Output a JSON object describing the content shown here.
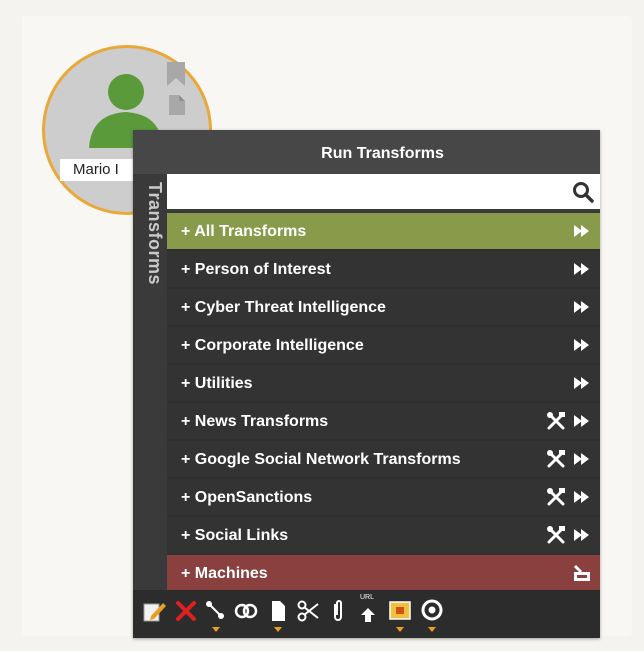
{
  "entity": {
    "label": "Mario I",
    "colors": {
      "border": "#e8a93a",
      "person": "#5a9a3a",
      "circle": "#cdcdcd"
    },
    "icons": [
      "person-icon",
      "bookmark-icon",
      "document-icon"
    ]
  },
  "menu": {
    "title": "Run Transforms",
    "side_tab": "Transforms",
    "search": {
      "value": "",
      "placeholder": ""
    },
    "items": [
      {
        "label": "+ All Transforms",
        "tools": false,
        "state": "active"
      },
      {
        "label": "+ Person of Interest",
        "tools": false
      },
      {
        "label": "+ Cyber Threat Intelligence",
        "tools": false
      },
      {
        "label": "+ Corporate Intelligence",
        "tools": false
      },
      {
        "label": "+ Utilities",
        "tools": false
      },
      {
        "label": "+ News Transforms",
        "tools": true
      },
      {
        "label": "+ Google Social Network Transforms",
        "tools": true
      },
      {
        "label": "+ OpenSanctions",
        "tools": true
      },
      {
        "label": "+ Social Links",
        "tools": true
      }
    ],
    "machines": {
      "label": "+ Machines"
    },
    "colors": {
      "active": "#8a9a4b",
      "machines": "#8b4040",
      "row": "#333333",
      "header": "#474747"
    }
  },
  "toolbar": {
    "icons": [
      "edit-icon",
      "delete-icon",
      "link-icon",
      "merge-icon",
      "copy-icon",
      "cut-icon",
      "attach-icon",
      "url-upload-icon",
      "screenshot-icon",
      "maltego-icon"
    ],
    "url_badge": "URL"
  }
}
